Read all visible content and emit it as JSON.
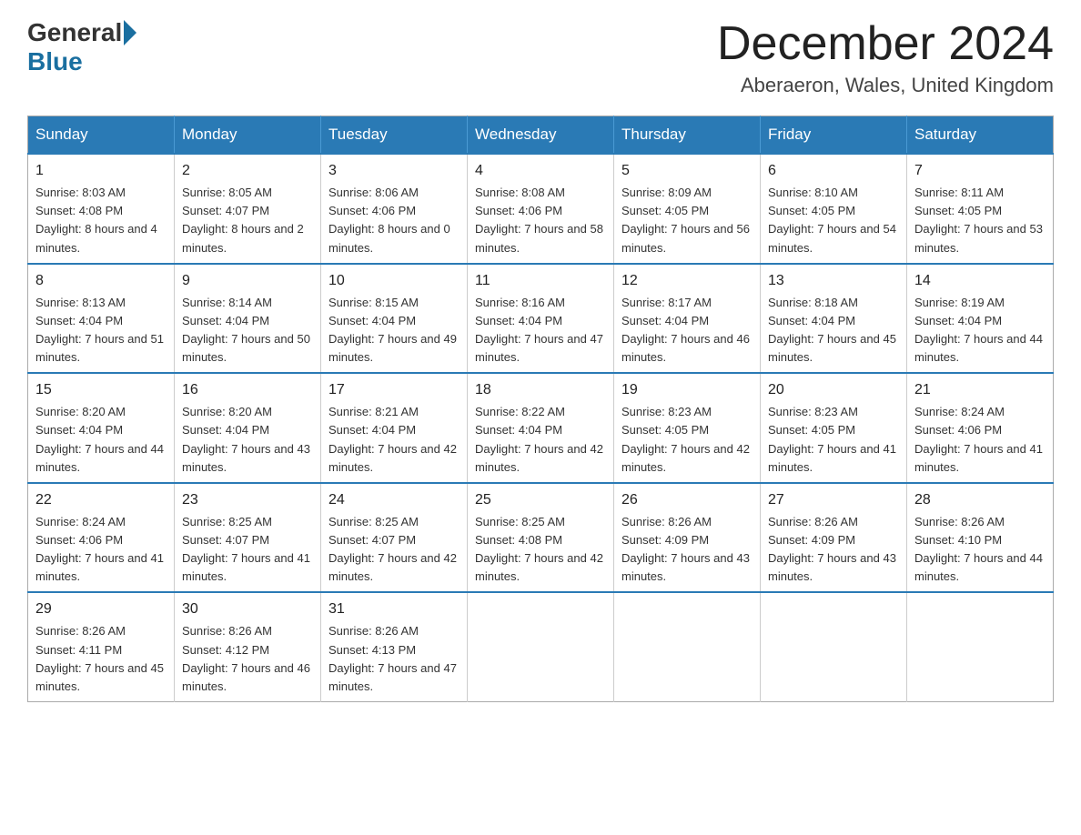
{
  "header": {
    "logo_text_general": "General",
    "logo_text_blue": "Blue",
    "month_title": "December 2024",
    "location": "Aberaeron, Wales, United Kingdom"
  },
  "weekdays": [
    "Sunday",
    "Monday",
    "Tuesday",
    "Wednesday",
    "Thursday",
    "Friday",
    "Saturday"
  ],
  "weeks": [
    [
      {
        "day": "1",
        "sunrise": "8:03 AM",
        "sunset": "4:08 PM",
        "daylight": "8 hours and 4 minutes."
      },
      {
        "day": "2",
        "sunrise": "8:05 AM",
        "sunset": "4:07 PM",
        "daylight": "8 hours and 2 minutes."
      },
      {
        "day": "3",
        "sunrise": "8:06 AM",
        "sunset": "4:06 PM",
        "daylight": "8 hours and 0 minutes."
      },
      {
        "day": "4",
        "sunrise": "8:08 AM",
        "sunset": "4:06 PM",
        "daylight": "7 hours and 58 minutes."
      },
      {
        "day": "5",
        "sunrise": "8:09 AM",
        "sunset": "4:05 PM",
        "daylight": "7 hours and 56 minutes."
      },
      {
        "day": "6",
        "sunrise": "8:10 AM",
        "sunset": "4:05 PM",
        "daylight": "7 hours and 54 minutes."
      },
      {
        "day": "7",
        "sunrise": "8:11 AM",
        "sunset": "4:05 PM",
        "daylight": "7 hours and 53 minutes."
      }
    ],
    [
      {
        "day": "8",
        "sunrise": "8:13 AM",
        "sunset": "4:04 PM",
        "daylight": "7 hours and 51 minutes."
      },
      {
        "day": "9",
        "sunrise": "8:14 AM",
        "sunset": "4:04 PM",
        "daylight": "7 hours and 50 minutes."
      },
      {
        "day": "10",
        "sunrise": "8:15 AM",
        "sunset": "4:04 PM",
        "daylight": "7 hours and 49 minutes."
      },
      {
        "day": "11",
        "sunrise": "8:16 AM",
        "sunset": "4:04 PM",
        "daylight": "7 hours and 47 minutes."
      },
      {
        "day": "12",
        "sunrise": "8:17 AM",
        "sunset": "4:04 PM",
        "daylight": "7 hours and 46 minutes."
      },
      {
        "day": "13",
        "sunrise": "8:18 AM",
        "sunset": "4:04 PM",
        "daylight": "7 hours and 45 minutes."
      },
      {
        "day": "14",
        "sunrise": "8:19 AM",
        "sunset": "4:04 PM",
        "daylight": "7 hours and 44 minutes."
      }
    ],
    [
      {
        "day": "15",
        "sunrise": "8:20 AM",
        "sunset": "4:04 PM",
        "daylight": "7 hours and 44 minutes."
      },
      {
        "day": "16",
        "sunrise": "8:20 AM",
        "sunset": "4:04 PM",
        "daylight": "7 hours and 43 minutes."
      },
      {
        "day": "17",
        "sunrise": "8:21 AM",
        "sunset": "4:04 PM",
        "daylight": "7 hours and 42 minutes."
      },
      {
        "day": "18",
        "sunrise": "8:22 AM",
        "sunset": "4:04 PM",
        "daylight": "7 hours and 42 minutes."
      },
      {
        "day": "19",
        "sunrise": "8:23 AM",
        "sunset": "4:05 PM",
        "daylight": "7 hours and 42 minutes."
      },
      {
        "day": "20",
        "sunrise": "8:23 AM",
        "sunset": "4:05 PM",
        "daylight": "7 hours and 41 minutes."
      },
      {
        "day": "21",
        "sunrise": "8:24 AM",
        "sunset": "4:06 PM",
        "daylight": "7 hours and 41 minutes."
      }
    ],
    [
      {
        "day": "22",
        "sunrise": "8:24 AM",
        "sunset": "4:06 PM",
        "daylight": "7 hours and 41 minutes."
      },
      {
        "day": "23",
        "sunrise": "8:25 AM",
        "sunset": "4:07 PM",
        "daylight": "7 hours and 41 minutes."
      },
      {
        "day": "24",
        "sunrise": "8:25 AM",
        "sunset": "4:07 PM",
        "daylight": "7 hours and 42 minutes."
      },
      {
        "day": "25",
        "sunrise": "8:25 AM",
        "sunset": "4:08 PM",
        "daylight": "7 hours and 42 minutes."
      },
      {
        "day": "26",
        "sunrise": "8:26 AM",
        "sunset": "4:09 PM",
        "daylight": "7 hours and 43 minutes."
      },
      {
        "day": "27",
        "sunrise": "8:26 AM",
        "sunset": "4:09 PM",
        "daylight": "7 hours and 43 minutes."
      },
      {
        "day": "28",
        "sunrise": "8:26 AM",
        "sunset": "4:10 PM",
        "daylight": "7 hours and 44 minutes."
      }
    ],
    [
      {
        "day": "29",
        "sunrise": "8:26 AM",
        "sunset": "4:11 PM",
        "daylight": "7 hours and 45 minutes."
      },
      {
        "day": "30",
        "sunrise": "8:26 AM",
        "sunset": "4:12 PM",
        "daylight": "7 hours and 46 minutes."
      },
      {
        "day": "31",
        "sunrise": "8:26 AM",
        "sunset": "4:13 PM",
        "daylight": "7 hours and 47 minutes."
      },
      null,
      null,
      null,
      null
    ]
  ]
}
